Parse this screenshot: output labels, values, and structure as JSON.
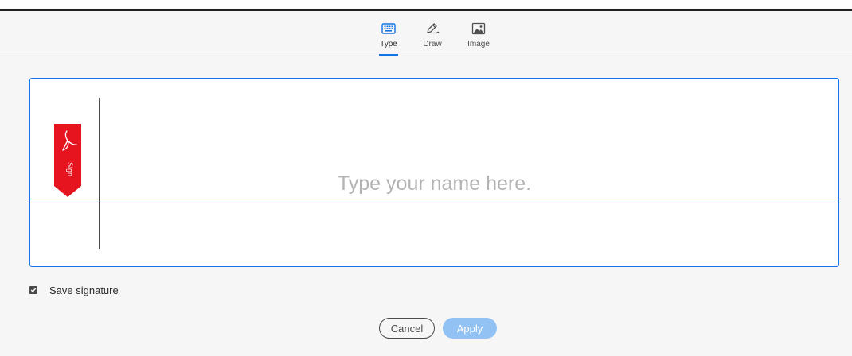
{
  "tabs": [
    {
      "label": "Type",
      "icon": "keyboard-icon",
      "active": true
    },
    {
      "label": "Draw",
      "icon": "pen-icon",
      "active": false
    },
    {
      "label": "Image",
      "icon": "image-icon",
      "active": false
    }
  ],
  "signature_box": {
    "placeholder": "Type your name here.",
    "sign_tag_text": "Sign"
  },
  "save_signature": {
    "label": "Save signature",
    "checked": true
  },
  "buttons": {
    "cancel": "Cancel",
    "apply": "Apply"
  },
  "colors": {
    "accent": "#1473e6",
    "apply_disabled": "#92c1f3",
    "sign_tag_red": "#e6141e"
  }
}
